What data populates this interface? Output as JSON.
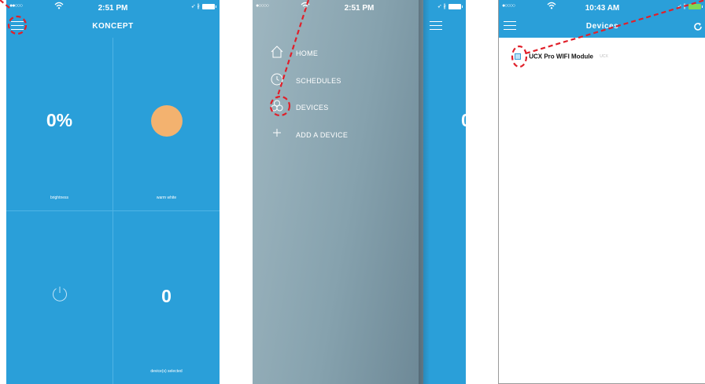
{
  "screen1": {
    "status": {
      "signal": "●●○○○",
      "time": "2:51 PM",
      "right_icons": "➶ ∦"
    },
    "title": "KONCEPT",
    "cells": [
      {
        "value": "0%",
        "label": "brightness"
      },
      {
        "value": "",
        "label": "warm white"
      },
      {
        "value": "",
        "label": ""
      },
      {
        "value": "0",
        "label": "device(s) selected"
      }
    ]
  },
  "screen2": {
    "status": {
      "signal": "●○○○○",
      "time": "2:51 PM",
      "right_icons": "➶ ∦"
    },
    "peek_value": "0",
    "menu": [
      {
        "label": "HOME",
        "icon": "home-icon"
      },
      {
        "label": "SCHEDULES",
        "icon": "clock-icon"
      },
      {
        "label": "DEVICES",
        "icon": "devices-icon"
      },
      {
        "label": "ADD A DEVICE",
        "icon": "plus-icon"
      }
    ]
  },
  "screen3": {
    "status": {
      "signal": "●○○○○",
      "time": "10:43 AM",
      "right_icons": "➶ ∦"
    },
    "title": "Devices",
    "devices": [
      {
        "name": "UCX Pro WIFI Module",
        "type": "UCX"
      }
    ]
  },
  "colors": {
    "app_blue": "#2a9fd9",
    "grid_line": "#4fb3e4",
    "warm_white_orb": "#f3b26f",
    "annotation_red": "#e0202a"
  }
}
